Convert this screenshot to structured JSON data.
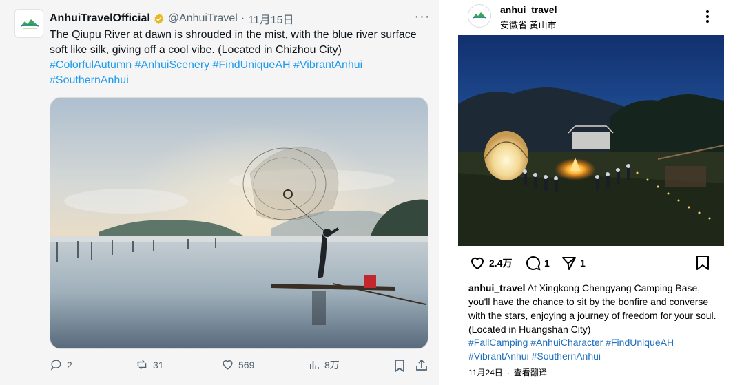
{
  "tweet": {
    "display_name": "AnhuiTravelOfficial",
    "handle": "@AnhuiTravel",
    "separator": "·",
    "date": "11月15日",
    "more": "···",
    "text": "The Qiupu River at dawn is shrouded in the mist, with the blue river surface soft like silk, giving off a cool vibe. (Located in Chizhou City)",
    "hashtags": [
      "#ColorfulAutumn",
      "#AnhuiScenery",
      "#FindUniqueAH",
      "#VibrantAnhui",
      "#SouthernAnhui"
    ],
    "actions": {
      "replies": "2",
      "reposts": "31",
      "likes": "569",
      "views": "8万"
    },
    "accent_color": "#1d9bf0",
    "verified_color": "#e8b923"
  },
  "instagram": {
    "username": "anhui_travel",
    "location": "安徽省 黄山市",
    "likes": "2.4万",
    "comments": "1",
    "shares": "1",
    "caption_user": "anhui_travel",
    "caption": " At Xingkong Chengyang Camping Base, you'll have the chance to sit by the bonfire and converse with the stars, enjoying a journey of freedom for your soul. (Located in Huangshan City)",
    "hashtags": [
      "#FallCamping",
      "#AnhuiCharacter",
      "#FindUniqueAH",
      "#VibrantAnhui",
      "#SouthernAnhui"
    ],
    "date": "11月24日",
    "dot": "·",
    "translate": "查看翻译",
    "hashtag_color": "#1d6fbf"
  }
}
